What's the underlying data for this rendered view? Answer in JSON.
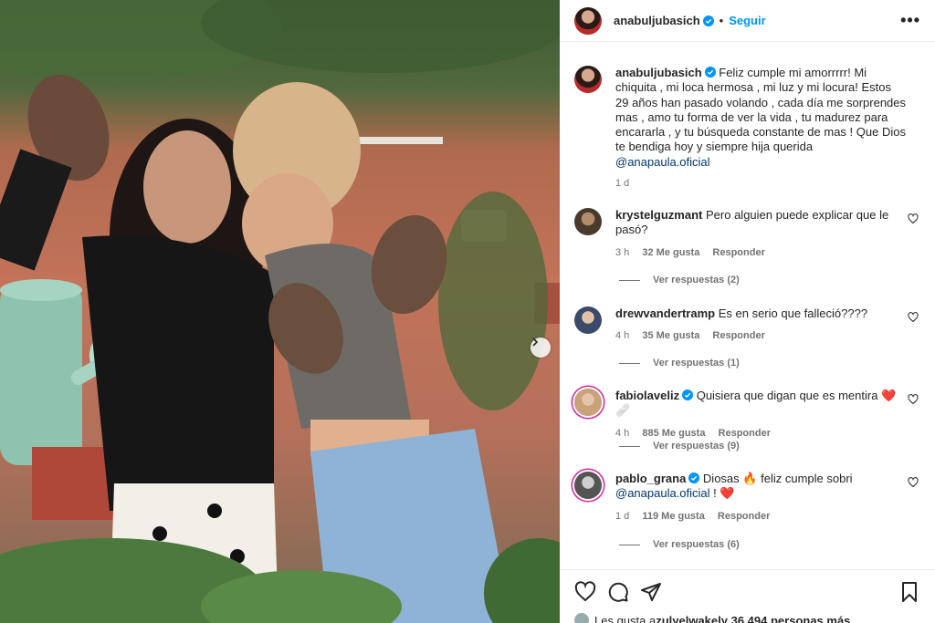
{
  "post": {
    "owner": "anabuljubasich",
    "follow_label": "Seguir",
    "more_label": "•••",
    "dot": "•",
    "carousel_next_icon": "chevron-right-icon"
  },
  "caption": {
    "username": "anabuljubasich",
    "text": "Feliz cumple mi amorrrrr! Mi chiquita , mi loca hermosa , mi luz y mi locura! Estos 29 años han pasado volando , cada día me sorprendes mas , amo tu forma de ver la vida , tu madurez para encararla , y tu búsqueda constante de mas ! Que Dios te bendiga hoy y siempre hija querida",
    "mention": "@anapaula.oficial",
    "time": "1 d"
  },
  "comments": [
    {
      "username": "krystelguzmant",
      "text": "Pero alguien puede explicar que le pasó?",
      "time": "3 h",
      "likes": "32 Me gusta",
      "reply": "Responder",
      "view_replies": "Ver respuestas (2)"
    },
    {
      "username": "drewvandertramp",
      "text": "Es en serio que falleció????",
      "time": "4 h",
      "likes": "35 Me gusta",
      "reply": "Responder",
      "view_replies": "Ver respuestas (1)"
    },
    {
      "username": "fabiolaveliz",
      "text": "Quisiera que digan que es mentira",
      "emoji": "❤️🩹",
      "time": "4 h",
      "likes": "885 Me gusta",
      "reply": "Responder",
      "view_replies": "Ver respuestas (9)"
    },
    {
      "username": "pablo_grana",
      "text_before": "Diosas",
      "emoji_fire": "🔥",
      "text_after": "feliz cumple sobri",
      "mention": "@anapaula.oficial",
      "trail": " !",
      "emoji_heart": "❤️",
      "time": "1 d",
      "likes": "119 Me gusta",
      "reply": "Responder",
      "view_replies": "Ver respuestas (6)"
    }
  ],
  "likes_summary": {
    "prefix": "Les gusta a ",
    "user": "zulyelwakel",
    "rest": " y 36.494 personas más"
  },
  "colors": {
    "link": "#0095f6",
    "verified": "#0095f6",
    "muted": "#737373",
    "text": "#262626"
  }
}
